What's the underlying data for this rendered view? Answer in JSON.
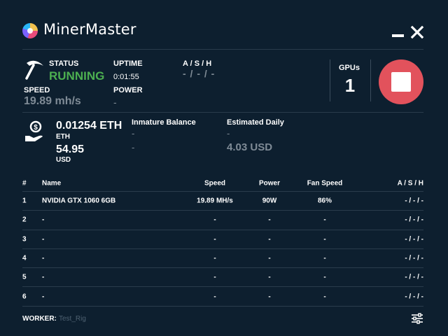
{
  "header": {
    "app_title": "MinerMaster",
    "minimize_icon": "minimize-icon",
    "close_icon": "close-icon"
  },
  "stats": {
    "status_label": "STATUS",
    "status_value": "RUNNING",
    "status_color": "#4caf50",
    "speed_label": "SPEED",
    "speed_value": "19.89 mh/s",
    "uptime_label": "UPTIME",
    "uptime_value": "0:01:55",
    "power_label": "POWER",
    "power_value": "-",
    "ash_label": "A / S / H",
    "ash_value": "- / - / -",
    "gpus_label": "GPUs",
    "gpus_value": "1",
    "stop_button_color": "#e2525c",
    "stop_icon": "stop-icon",
    "pickaxe_icon": "pickaxe-icon"
  },
  "balance": {
    "money_icon": "money-hand-icon",
    "eth_value": "0.01254 ETH",
    "eth_unit": "ETH",
    "usd_value": "54.95",
    "usd_unit": "USD",
    "immature_label": "Inmature Balance",
    "immature_value_1": "-",
    "immature_value_2": "-",
    "estimated_label": "Estimated Daily",
    "estimated_value_1": "-",
    "estimated_value_2": "4.03 USD"
  },
  "table": {
    "headers": {
      "index": "#",
      "name": "Name",
      "speed": "Speed",
      "power": "Power",
      "fan": "Fan Speed",
      "ash": "A / S / H"
    },
    "rows": [
      {
        "index": "1",
        "name": "NVIDIA GTX 1060 6GB",
        "speed": "19.89 MH/s",
        "power": "90W",
        "fan": "86%",
        "ash": "- / - / -"
      },
      {
        "index": "2",
        "name": "-",
        "speed": "-",
        "power": "-",
        "fan": "-",
        "ash": "- / - / -"
      },
      {
        "index": "3",
        "name": "-",
        "speed": "-",
        "power": "-",
        "fan": "-",
        "ash": "- / - / -"
      },
      {
        "index": "4",
        "name": "-",
        "speed": "-",
        "power": "-",
        "fan": "-",
        "ash": "- / - / -"
      },
      {
        "index": "5",
        "name": "-",
        "speed": "-",
        "power": "-",
        "fan": "-",
        "ash": "- / - / -"
      },
      {
        "index": "6",
        "name": "-",
        "speed": "-",
        "power": "-",
        "fan": "-",
        "ash": "- / - / -"
      }
    ]
  },
  "footer": {
    "worker_label": "WORKER:",
    "worker_value": "Test_Rig",
    "settings_icon": "sliders-icon"
  },
  "colors": {
    "background": "#0d1f2f",
    "accent_green": "#4caf50",
    "accent_red": "#e2525c",
    "muted_text": "#7f8b96"
  }
}
